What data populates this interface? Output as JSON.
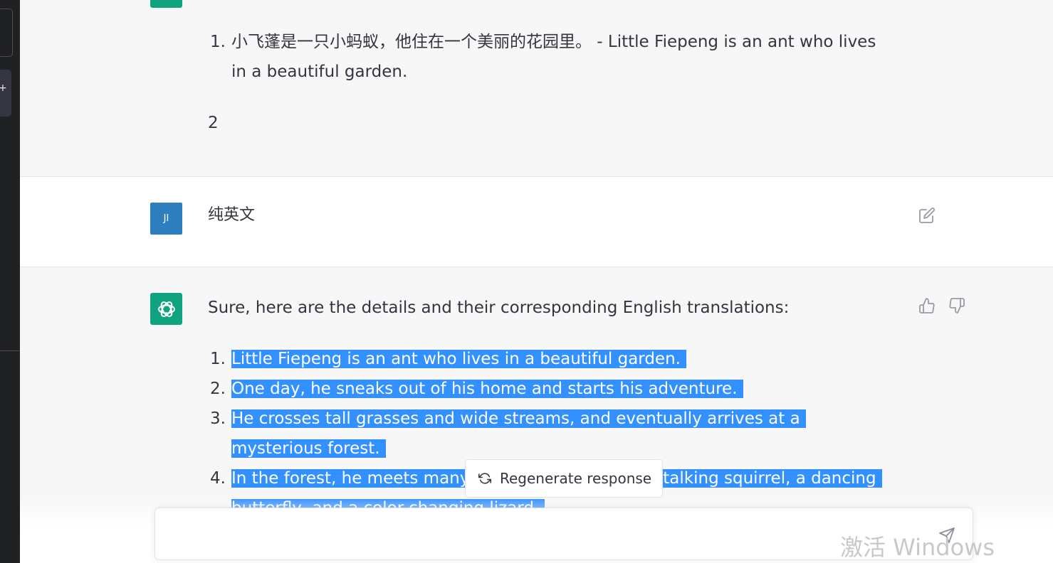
{
  "conversation": {
    "prev_response": {
      "item_num": "1.",
      "item_text": "小飞蓬是一只小蚂蚁，他住在一个美丽的花园里。 - Little Fiepeng is an ant who lives in a beautiful garden.",
      "trailing_text": "2"
    },
    "user_message": {
      "avatar_initials": "JI",
      "text": "纯英文"
    },
    "response": {
      "intro": "Sure, here are the details and their corresponding English translations:",
      "items": [
        {
          "num": "1.",
          "text": "Little Fiepeng is an ant who lives in a beautiful garden."
        },
        {
          "num": "2.",
          "text": "One day, he sneaks out of his home and starts his adventure."
        },
        {
          "num": "3.",
          "text": "He crosses tall grasses and wide streams, and eventually arrives at a mysterious forest."
        },
        {
          "num": "4.",
          "text": "In the forest, he meets many new friends, such as a talking squirrel, a dancing butterfly, and a color-changing lizard."
        }
      ]
    }
  },
  "regenerate_button": {
    "label": "Regenerate response",
    "icon": "refresh-icon"
  },
  "composer": {
    "placeholder": "",
    "send_icon": "send-icon"
  },
  "watermark": {
    "text": "激活 Windows"
  },
  "colors": {
    "assistant_avatar": "#10a37f",
    "user_avatar": "#2e7fbf",
    "selection": "#3390ff",
    "sidebar": "#202123"
  }
}
